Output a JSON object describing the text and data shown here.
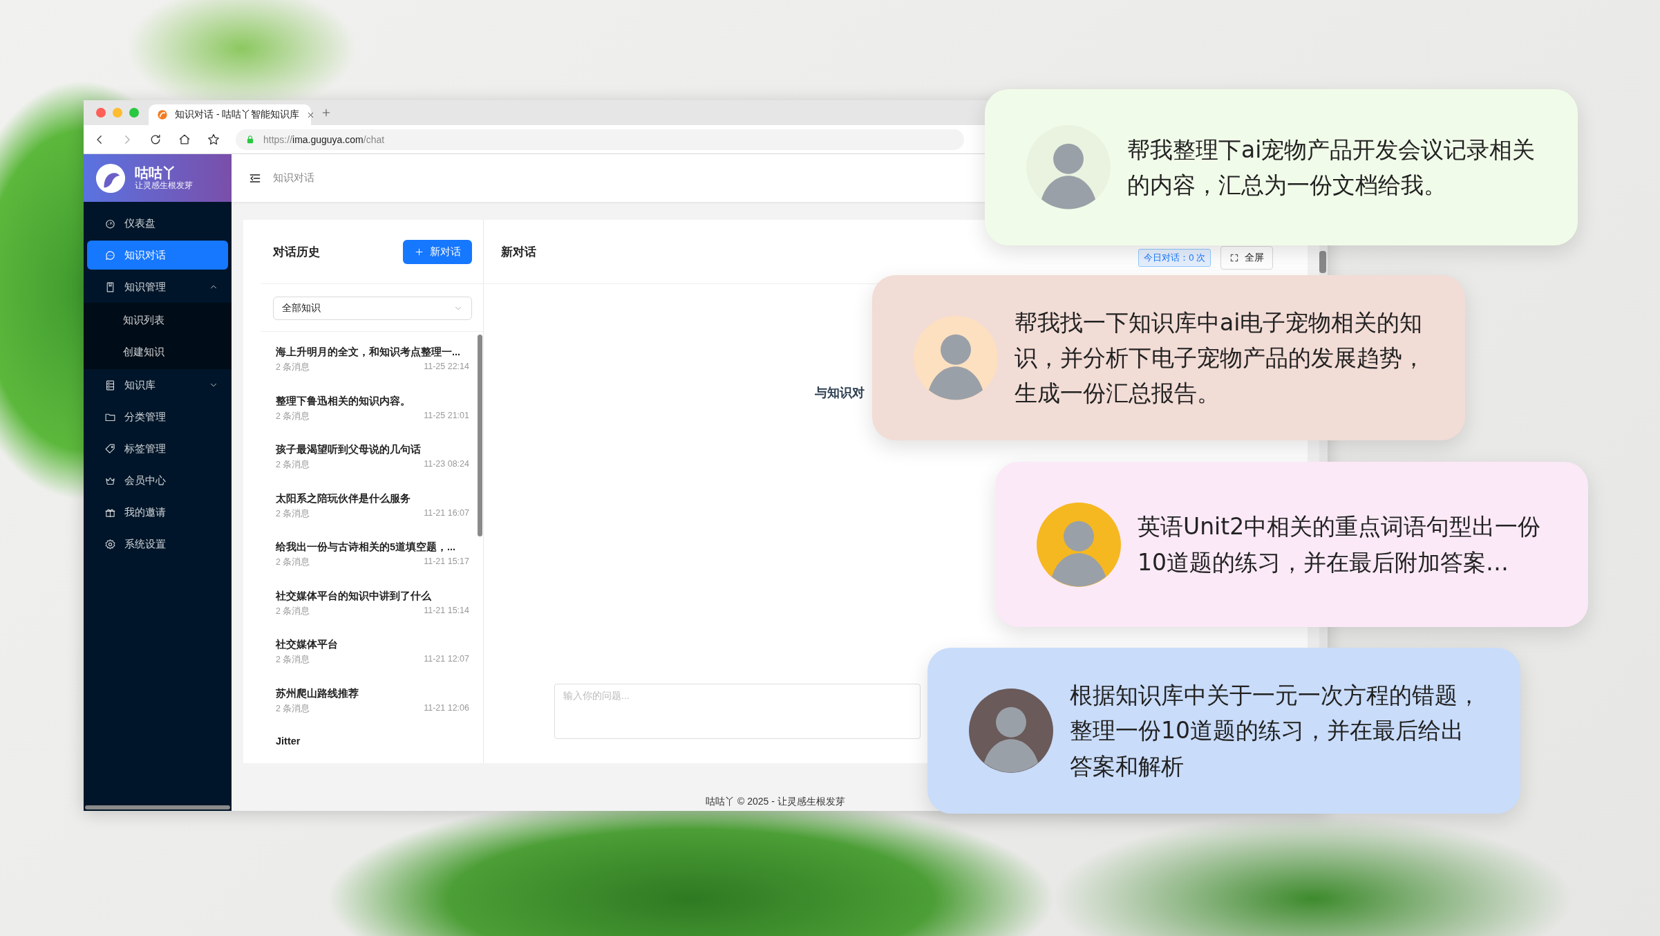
{
  "browser": {
    "tab_title": "知识对话 - 咕咕丫智能知识库",
    "url": "https://**ima.guguya.com**/chat"
  },
  "app": {
    "brand": "咕咕丫",
    "slogan": "让灵感生根发芽",
    "breadcrumb": "知识对话"
  },
  "sidebar": {
    "items": [
      {
        "label": "仪表盘",
        "kind": "link",
        "selected": false
      },
      {
        "label": "知识对话",
        "kind": "link",
        "selected": true
      },
      {
        "label": "知识管理",
        "kind": "group",
        "selected": false,
        "expanded": true,
        "children": [
          {
            "label": "知识列表",
            "selected": false
          },
          {
            "label": "创建知识",
            "selected": false
          }
        ]
      },
      {
        "label": "知识库",
        "kind": "group",
        "selected": false,
        "expanded": false
      },
      {
        "label": "分类管理",
        "kind": "link",
        "selected": false
      },
      {
        "label": "标签管理",
        "kind": "link",
        "selected": false
      },
      {
        "label": "会员中心",
        "kind": "link",
        "selected": false
      },
      {
        "label": "我的邀请",
        "kind": "link",
        "selected": false
      },
      {
        "label": "系统设置",
        "kind": "link",
        "selected": false
      }
    ]
  },
  "history": {
    "title": "对话历史",
    "new_button": "新对话",
    "filter": "全部知识",
    "conversations": [
      {
        "title": "海上升明月的全文，和知识考点整理一...",
        "count": "2 条消息",
        "time": "11-25 22:14"
      },
      {
        "title": "整理下鲁迅相关的知识内容。",
        "count": "2 条消息",
        "time": "11-25 21:01"
      },
      {
        "title": "孩子最渴望听到父母说的几句话",
        "count": "2 条消息",
        "time": "11-23 08:24"
      },
      {
        "title": "太阳系之陪玩伙伴是什么服务",
        "count": "2 条消息",
        "time": "11-21 16:07"
      },
      {
        "title": "给我出一份与古诗相关的5道填空题，...",
        "count": "2 条消息",
        "time": "11-21 15:17"
      },
      {
        "title": "社交媒体平台的知识中讲到了什么",
        "count": "2 条消息",
        "time": "11-21 15:14"
      },
      {
        "title": "社交媒体平台",
        "count": "2 条消息",
        "time": "11-21 12:07"
      },
      {
        "title": "苏州爬山路线推荐",
        "count": "2 条消息",
        "time": "11-21 12:06"
      },
      {
        "title": "Jitter"
      }
    ]
  },
  "chat": {
    "title": "新对话",
    "today_badge": "今日对话：0 次",
    "fullscreen_button": "全屏",
    "empty_text": "与知识对",
    "input": {
      "placeholder": "输入你的问题..."
    }
  },
  "footer": "咕咕丫 © 2025 - 让灵感生根发芽",
  "bubbles": [
    {
      "text": "帮我整理下ai宠物产品开发会议记录相关的内容，汇总为一份文档给我。",
      "color": "#f1fbe9"
    },
    {
      "text": "帮我找一下知识库中ai电子宠物相关的知识，并分析下电子宠物产品的发展趋势，生成一份汇总报告。",
      "color": "#f2dcd6"
    },
    {
      "text": "英语Unit2中相关的重点词语句型出一份10道题的练习，并在最后附加答案…",
      "color": "#fbe9f7"
    },
    {
      "text": "根据知识库中关于一元一次方程的错题，整理一份10道题的练习，并在最后给出答案和解析",
      "color": "#c9dcfa"
    }
  ]
}
